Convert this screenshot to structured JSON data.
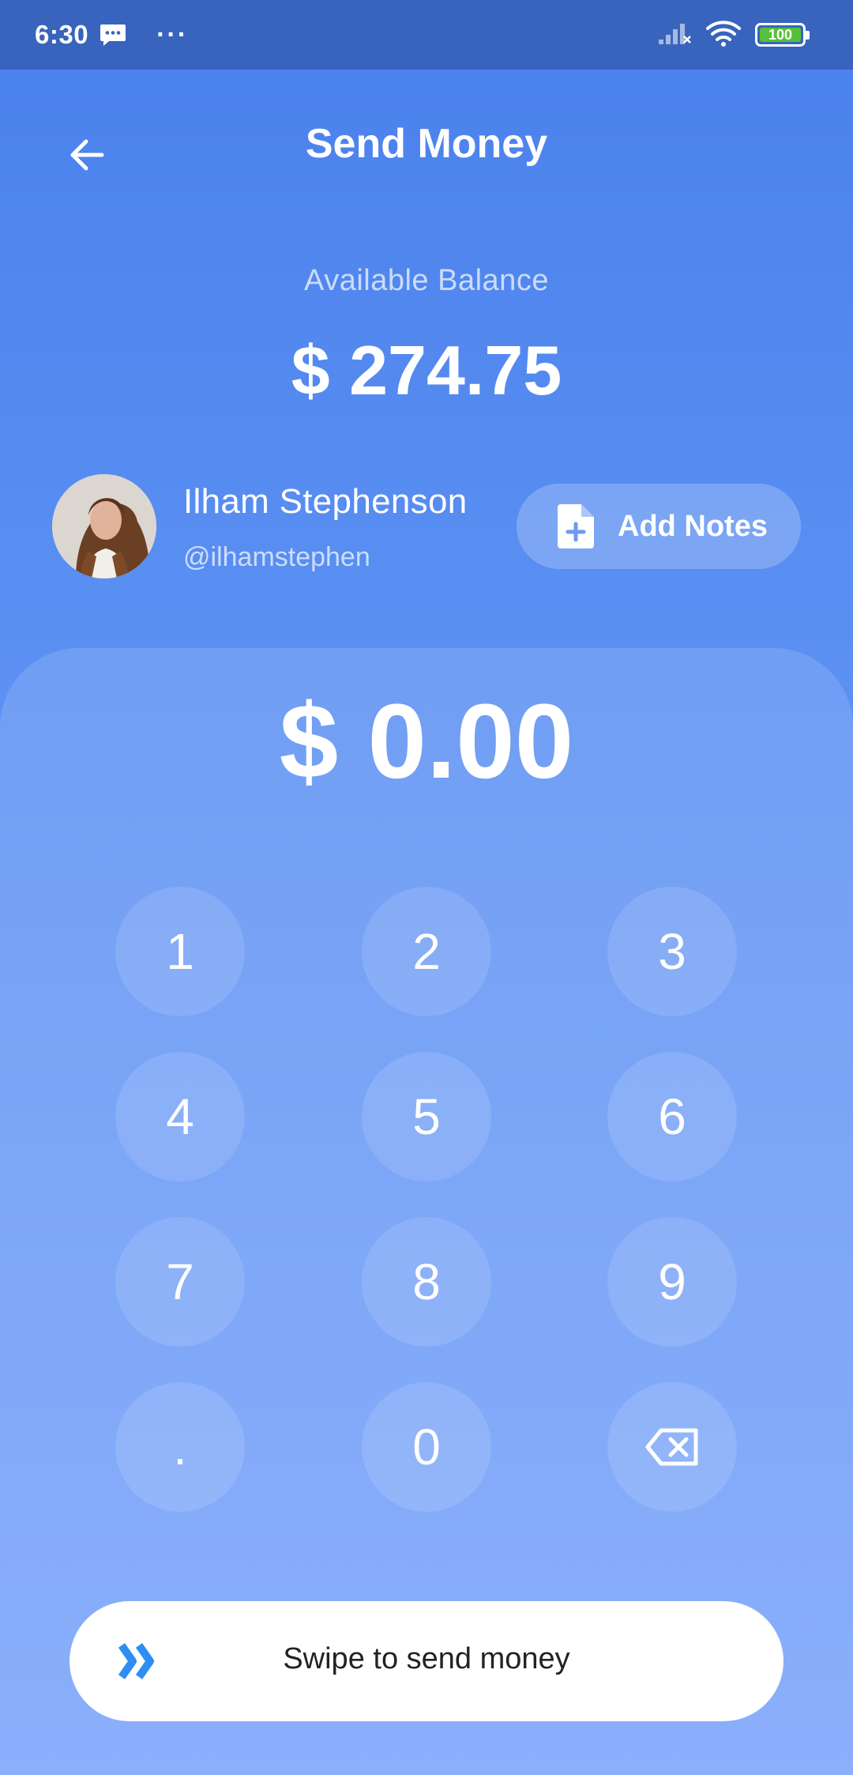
{
  "status_bar": {
    "time": "6:30",
    "more_indicator": "···",
    "battery": "100",
    "icons": [
      "message-icon",
      "signal-icon",
      "wifi-icon",
      "battery-icon"
    ]
  },
  "header": {
    "title": "Send Money",
    "back_icon": "arrow-left-icon"
  },
  "balance": {
    "label": "Available Balance",
    "value": "$ 274.75"
  },
  "recipient": {
    "name": "Ilham Stephenson",
    "handle": "@ilhamstephen",
    "avatar_icon": "avatar"
  },
  "add_notes": {
    "label": "Add Notes",
    "icon": "file-plus-icon"
  },
  "amount": "$ 0.00",
  "keypad": {
    "keys": [
      "1",
      "2",
      "3",
      "4",
      "5",
      "6",
      "7",
      "8",
      "9",
      ".",
      "0"
    ],
    "backspace_icon": "backspace-icon"
  },
  "swipe": {
    "label": "Swipe to send money",
    "icon": "double-chevron-right-icon",
    "icon_color": "#2f8ef2"
  },
  "colors": {
    "status_bar": "#3864bd",
    "background_top": "#4a80ec",
    "background_bottom": "#7aa4fb",
    "battery_fill": "#55c13a"
  }
}
